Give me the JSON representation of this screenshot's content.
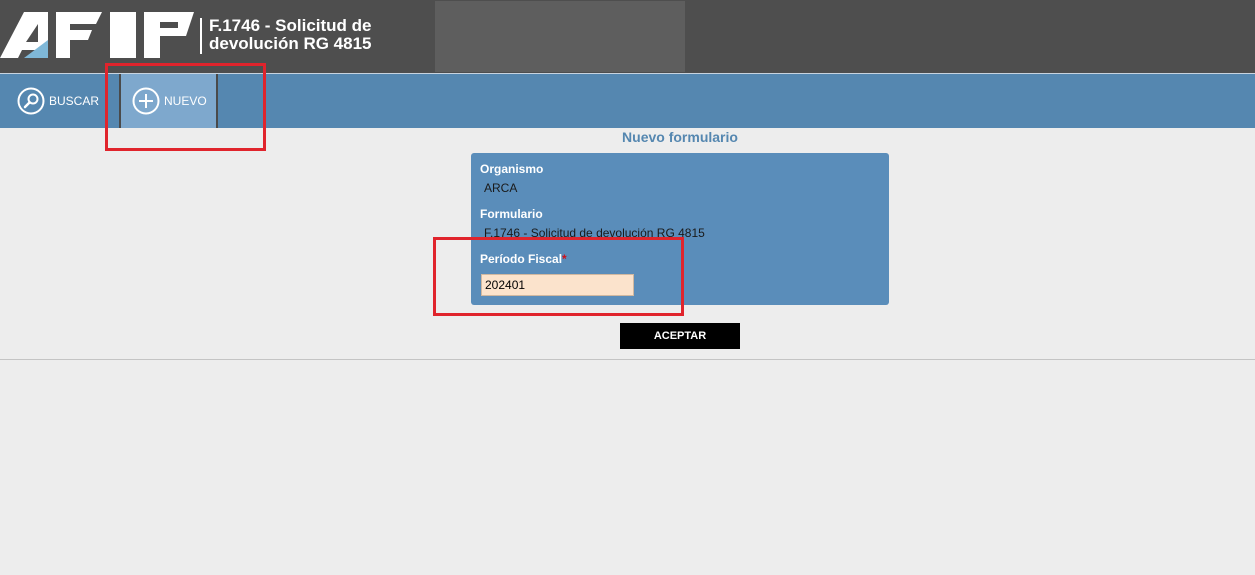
{
  "header": {
    "logo_text": "AFIP",
    "title_line1": "F.1746 - Solicitud de",
    "title_line2": "devolución RG 4815"
  },
  "toolbar": {
    "buscar_label": "BUSCAR",
    "nuevo_label": "NUEVO",
    "buscar_icon": "search-icon",
    "nuevo_icon": "plus-circle-icon"
  },
  "form": {
    "heading": "Nuevo formulario",
    "organismo_label": "Organismo",
    "organismo_value": "ARCA",
    "formulario_label": "Formulario",
    "formulario_value": "F.1746 - Solicitud de devolución RG 4815",
    "periodo_label": "Período Fiscal",
    "required_mark": "*",
    "periodo_value": "202401",
    "accept_label": "ACEPTAR"
  },
  "colors": {
    "header_bg": "#4e4e4e",
    "toolbar_bg": "#5587b0",
    "panel_bg": "#5a8dba",
    "highlight": "#e0242c",
    "input_bg": "#fbe3cc"
  }
}
